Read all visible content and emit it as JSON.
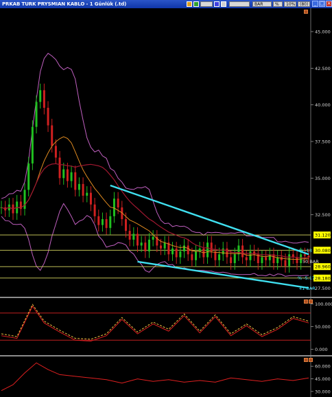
{
  "window": {
    "title": "PRKAB TURK PRYSMIAN KABLO - 1 Günlük (.td)",
    "toolbar": {
      "field1": "",
      "field2": "",
      "bar_label": "BAR",
      "percent_label": "%",
      "pct_value": "10%",
      "bar_count": "(80)"
    }
  },
  "chart_data": [
    {
      "type": "line",
      "panel": "price",
      "yaxis_ticks": [
        45.0,
        42.5,
        40.0,
        37.5,
        35.0,
        32.5,
        27.5
      ],
      "ylim": [
        27.0,
        46.5
      ],
      "x": [
        1,
        2,
        3,
        4,
        5,
        6,
        7,
        8,
        9,
        10,
        11,
        12,
        13,
        14,
        15,
        16,
        17,
        18,
        19,
        20,
        21,
        22,
        23,
        24,
        25,
        26,
        27,
        28,
        29,
        30,
        31,
        32,
        33,
        34,
        35,
        36,
        37,
        38,
        39,
        40,
        41,
        42,
        43,
        44,
        45,
        46,
        47,
        48,
        49,
        50,
        51,
        52,
        53,
        54,
        55,
        56,
        57,
        58,
        59,
        60,
        61,
        62,
        63,
        64,
        65,
        66,
        67,
        68,
        69,
        70,
        71,
        72,
        73,
        74,
        75,
        76,
        77,
        78,
        79,
        80
      ],
      "close": [
        33.0,
        32.8,
        33.2,
        32.6,
        33.4,
        32.9,
        34.2,
        36.0,
        38.5,
        40.2,
        41.0,
        39.8,
        38.6,
        37.2,
        36.4,
        35.0,
        35.6,
        34.8,
        35.4,
        34.2,
        34.6,
        33.8,
        34.0,
        33.2,
        32.4,
        31.8,
        32.2,
        31.6,
        32.4,
        33.6,
        33.0,
        32.2,
        31.4,
        30.8,
        31.2,
        30.4,
        30.6,
        30.0,
        30.8,
        31.0,
        30.4,
        30.2,
        30.6,
        29.8,
        30.2,
        29.6,
        30.0,
        30.4,
        29.8,
        29.4,
        30.0,
        30.2,
        29.6,
        30.6,
        30.0,
        29.4,
        29.8,
        30.2,
        29.6,
        29.2,
        29.8,
        30.4,
        29.6,
        29.4,
        30.0,
        29.8,
        29.2,
        29.6,
        29.4,
        29.8,
        29.2,
        29.6,
        29.4,
        29.0,
        29.8,
        29.6,
        29.2,
        29.8,
        29.7,
        29.6
      ],
      "horizontal_levels": [
        {
          "value": 31.12,
          "label": "31.120"
        },
        {
          "value": 30.08,
          "label": "30.080"
        },
        {
          "value": 28.96,
          "label": "28.960"
        },
        {
          "value": 28.18,
          "label": "28.180"
        }
      ],
      "trendlines": [
        {
          "from": [
            29,
            34.5
          ],
          "to": [
            80,
            29.8
          ]
        },
        {
          "from": [
            36,
            29.3
          ],
          "to": [
            80,
            27.5
          ]
        }
      ],
      "annotations": {
        "upper_pct": "% -13",
        "upper_bars": "50 BAR",
        "lower_pct": "% -5.17",
        "lower_bars": "41 BAR"
      }
    },
    {
      "type": "line",
      "panel": "oscillator-1",
      "yaxis_ticks": [
        100.0,
        50.0,
        0.0
      ],
      "ylim": [
        -10,
        110
      ],
      "x": [
        1,
        5,
        9,
        12,
        16,
        20,
        24,
        28,
        32,
        36,
        40,
        44,
        48,
        52,
        56,
        60,
        64,
        68,
        72,
        76,
        80
      ],
      "values": [
        30,
        24,
        95,
        58,
        38,
        20,
        18,
        30,
        66,
        34,
        56,
        40,
        74,
        36,
        72,
        30,
        52,
        28,
        44,
        68,
        58
      ]
    },
    {
      "type": "line",
      "panel": "oscillator-2",
      "yaxis_ticks": [
        60.0,
        45.0,
        30.0
      ],
      "ylim": [
        25,
        70
      ],
      "x": [
        1,
        4,
        7,
        10,
        13,
        16,
        20,
        24,
        28,
        32,
        36,
        40,
        44,
        48,
        52,
        56,
        60,
        64,
        68,
        72,
        76,
        80
      ],
      "values": [
        31,
        38,
        52,
        64,
        56,
        50,
        48,
        46,
        44,
        40,
        45,
        42,
        44,
        41,
        43,
        41,
        46,
        44,
        42,
        45,
        43,
        46
      ]
    }
  ]
}
